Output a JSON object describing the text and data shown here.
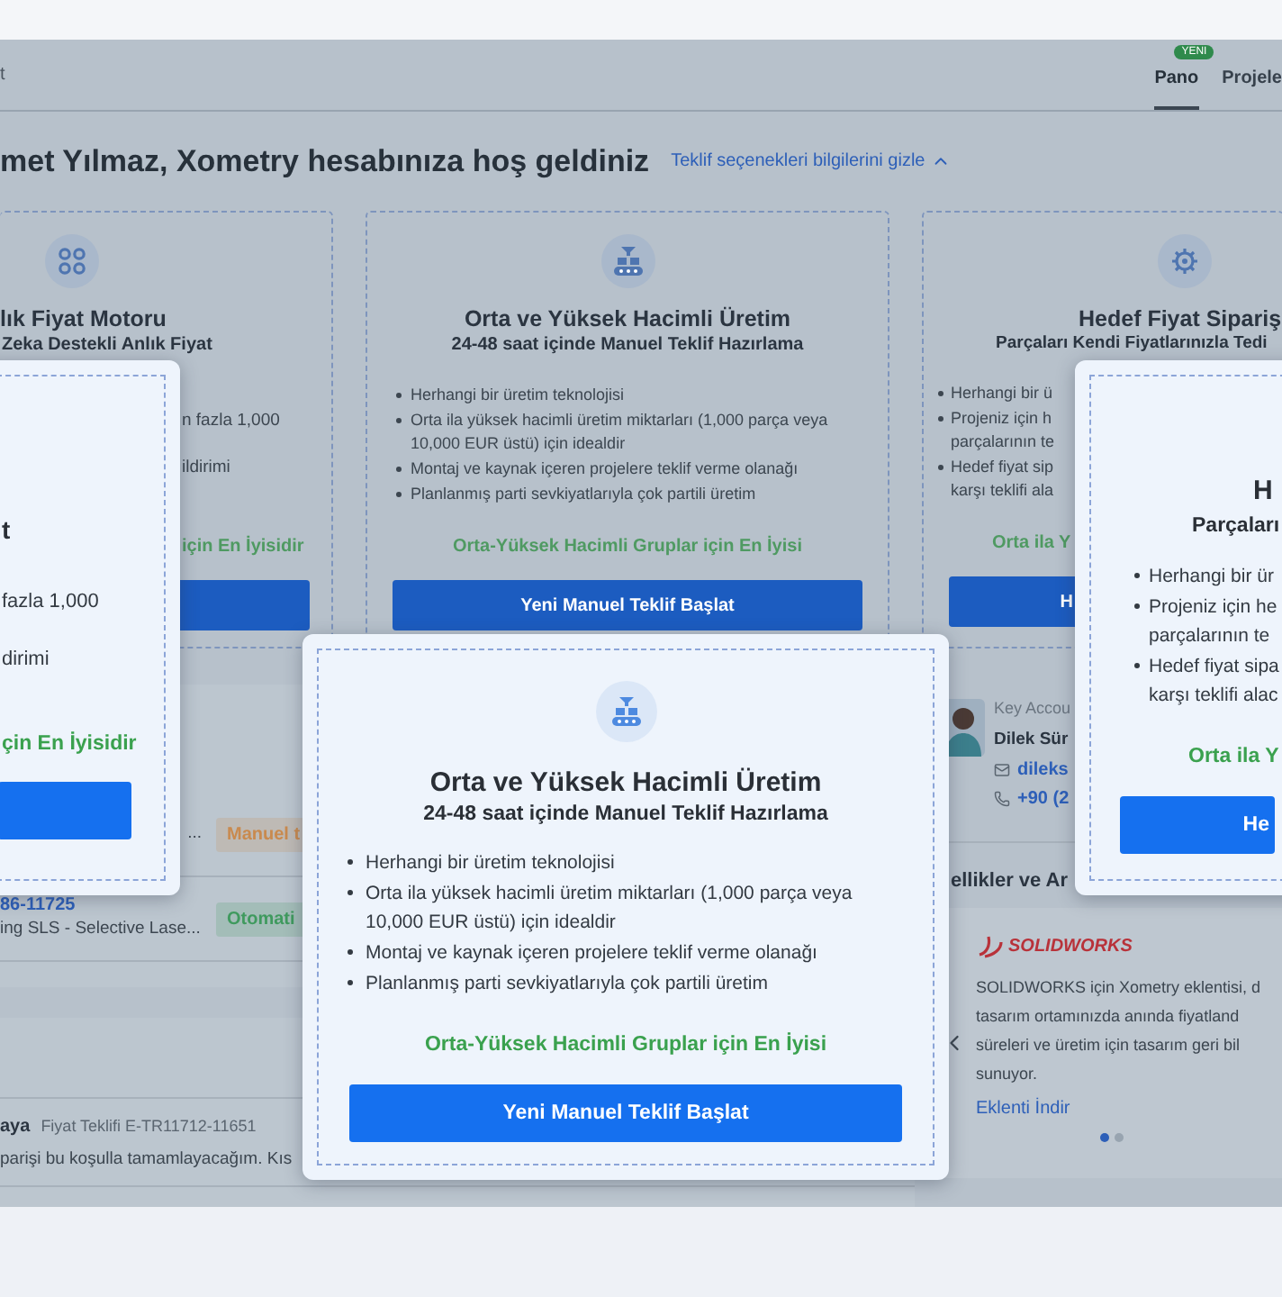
{
  "top_bar": {
    "left_text": "t",
    "tabs": [
      {
        "label": "Pano",
        "badge": "YENI",
        "selected": true
      },
      {
        "label": "Projele",
        "selected": false
      }
    ]
  },
  "welcome": {
    "title": "met Yılmaz, Xometry hesabınıza hoş geldiniz",
    "toggle_link": "Teklif seçenekleri bilgilerini gizle"
  },
  "option_cards": [
    {
      "title": "lık Fiyat Motoru",
      "subtitle": "Zeka Destekli Anlık Fiyat",
      "fragments": [
        "n fazla 1,000",
        "ildirimi"
      ],
      "best_for": "için En İyisidir"
    },
    {
      "title": "Orta ve Yüksek Hacimli Üretim",
      "subtitle": "24-48 saat içinde Manuel Teklif Hazırlama",
      "bullets": [
        {
          "lines": [
            "Herhangi bir üretim teknolojisi"
          ]
        },
        {
          "lines": [
            "Orta ila yüksek hacimli üretim miktarları (1,000 parça veya",
            "10,000 EUR üstü) için idealdir"
          ]
        },
        {
          "lines": [
            "Montaj ve kaynak içeren projelere teklif verme olanağı"
          ]
        },
        {
          "lines": [
            "Planlanmış parti sevkiyatlarıyla çok partili üretim"
          ]
        }
      ],
      "best_for": "Orta-Yüksek Hacimli Gruplar için En İyisi",
      "button": "Yeni Manuel Teklif Başlat"
    },
    {
      "title": "Hedef Fiyat Sipariş",
      "subtitle": "Parçaları Kendi Fiyatlarınızla Tedi",
      "bullets": [
        {
          "lines": [
            "Herhangi bir ü"
          ]
        },
        {
          "lines": [
            "Projeniz için h",
            "parçalarının te"
          ]
        },
        {
          "lines": [
            "Hedef fiyat sip",
            "karşı teklifi ala"
          ]
        }
      ],
      "best_for": "Orta ila Y",
      "button": "H"
    }
  ],
  "quotes": {
    "rows": [
      {
        "text": "...",
        "tag": "Manuel t",
        "color": "#c98a4e"
      },
      {
        "link": "86-11725",
        "text": "ing SLS - Selective Lase...",
        "tag": "Otomati",
        "color": "#3f9a5e"
      }
    ]
  },
  "messages": {
    "rows": [
      {
        "sender": "aya",
        "reference": "Fiyat Teklifi E-TR11712-11651",
        "text": "parişi bu koşulla tamamlayacağım. Kıs"
      }
    ]
  },
  "account_manager": {
    "role": "Key Accou",
    "name": "Dilek Sür",
    "email": "dileks",
    "phone": "+90 (2"
  },
  "integrations": {
    "heading": "ellikler ve Ar",
    "logo": "SOLIDWORKS",
    "lines": [
      "SOLIDWORKS için Xometry eklentisi, d",
      "tasarım ortamınızda anında fiyatland",
      "süreleri ve üretim için tasarım geri bil",
      "sunuyor."
    ],
    "link": "Eklenti İndir",
    "dots": [
      {
        "selected": true
      },
      {
        "selected": false
      }
    ]
  },
  "popups": [
    {
      "title": "t",
      "fragments": [
        "fazla 1,000",
        "dirimi"
      ],
      "best_for": "çin En İyisidir"
    },
    {
      "title": "Orta ve Yüksek Hacimli Üretim",
      "subtitle": "24-48 saat içinde Manuel Teklif Hazırlama",
      "bullets": [
        {
          "lines": [
            "Herhangi bir üretim teknolojisi"
          ]
        },
        {
          "lines": [
            "Orta ila yüksek hacimli üretim miktarları (1,000 parça veya",
            "10,000 EUR üstü) için idealdir"
          ]
        },
        {
          "lines": [
            "Montaj ve kaynak içeren projelere teklif verme olanağı"
          ]
        },
        {
          "lines": [
            "Planlanmış parti sevkiyatlarıyla çok partili üretim"
          ]
        }
      ],
      "best_for": "Orta-Yüksek Hacimli Gruplar için En İyisi",
      "button": "Yeni Manuel Teklif Başlat"
    },
    {
      "title": "H",
      "subtitle": "Parçaları",
      "bullets": [
        {
          "lines": [
            "Herhangi bir ür"
          ]
        },
        {
          "lines": [
            "Projeniz için he",
            "parçalarının te"
          ]
        },
        {
          "lines": [
            "Hedef fiyat sipa",
            "karşı teklifi alac"
          ]
        }
      ],
      "best_for": "Orta ila Y",
      "button": "He"
    }
  ]
}
